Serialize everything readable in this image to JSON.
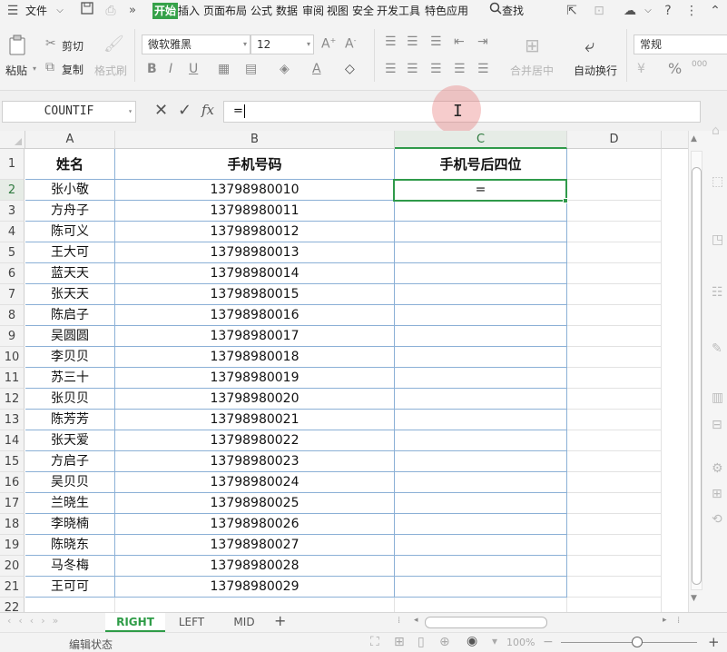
{
  "menu": {
    "file": "文件",
    "tabs": [
      "开始",
      "插入",
      "页面布局",
      "公式",
      "数据",
      "审阅",
      "视图",
      "安全",
      "开发工具",
      "特色应用"
    ],
    "search": "查找"
  },
  "ribbon": {
    "paste": "粘贴",
    "cut": "剪切",
    "copy": "复制",
    "format_painter": "格式刷",
    "font_name": "微软雅黑",
    "font_size": "12",
    "merge_center": "合并居中",
    "wrap_text": "自动换行",
    "number_format": "常规"
  },
  "formula_bar": {
    "name_box": "COUNTIF",
    "fx": "fx",
    "content": "="
  },
  "columns": [
    "A",
    "B",
    "C",
    "D"
  ],
  "rows": [
    1,
    2,
    3,
    4,
    5,
    6,
    7,
    8,
    9,
    10,
    11,
    12,
    13,
    14,
    15,
    16,
    17,
    18,
    19,
    20,
    21,
    22
  ],
  "table": {
    "headers": [
      "姓名",
      "手机号码",
      "手机号后四位"
    ],
    "records": [
      {
        "name": "张小敬",
        "phone": "13798980010",
        "last4": "="
      },
      {
        "name": "方舟子",
        "phone": "13798980011",
        "last4": ""
      },
      {
        "name": "陈可义",
        "phone": "13798980012",
        "last4": ""
      },
      {
        "name": "王大可",
        "phone": "13798980013",
        "last4": ""
      },
      {
        "name": "蓝天天",
        "phone": "13798980014",
        "last4": ""
      },
      {
        "name": "张天天",
        "phone": "13798980015",
        "last4": ""
      },
      {
        "name": "陈启子",
        "phone": "13798980016",
        "last4": ""
      },
      {
        "name": "吴圆圆",
        "phone": "13798980017",
        "last4": ""
      },
      {
        "name": "李贝贝",
        "phone": "13798980018",
        "last4": ""
      },
      {
        "name": "苏三十",
        "phone": "13798980019",
        "last4": ""
      },
      {
        "name": "张贝贝",
        "phone": "13798980020",
        "last4": ""
      },
      {
        "name": "陈芳芳",
        "phone": "13798980021",
        "last4": ""
      },
      {
        "name": "张天爱",
        "phone": "13798980022",
        "last4": ""
      },
      {
        "name": "方启子",
        "phone": "13798980023",
        "last4": ""
      },
      {
        "name": "吴贝贝",
        "phone": "13798980024",
        "last4": ""
      },
      {
        "name": "兰晓生",
        "phone": "13798980025",
        "last4": ""
      },
      {
        "name": "李晓楠",
        "phone": "13798980026",
        "last4": ""
      },
      {
        "name": "陈晓东",
        "phone": "13798980027",
        "last4": ""
      },
      {
        "name": "马冬梅",
        "phone": "13798980028",
        "last4": ""
      },
      {
        "name": "王可可",
        "phone": "13798980029",
        "last4": ""
      }
    ]
  },
  "sheets": [
    "RIGHT",
    "LEFT",
    "MID"
  ],
  "active_sheet": "RIGHT",
  "status": {
    "mode": "编辑状态",
    "zoom": "100%"
  },
  "colors": {
    "accent": "#35a149",
    "cell_border": "#8bb0d6"
  }
}
